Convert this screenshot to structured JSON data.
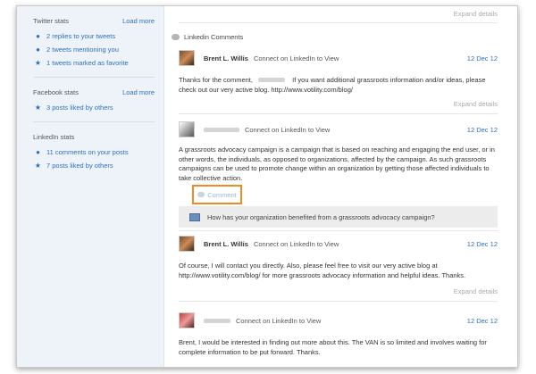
{
  "sidebar": {
    "twitter": {
      "title": "Twitter stats",
      "load_more": "Load more",
      "items": [
        {
          "icon": "speech-bubble-icon",
          "label": "2 replies to your tweets"
        },
        {
          "icon": "speech-bubble-icon",
          "label": "2 tweets mentioning you"
        },
        {
          "icon": "star-icon",
          "label": "1 tweets marked as favorite"
        }
      ]
    },
    "facebook": {
      "title": "Facebook stats",
      "load_more": "Load more",
      "items": [
        {
          "icon": "star-icon",
          "label": "3 posts liked by others"
        }
      ]
    },
    "linkedin": {
      "title": "LinkedIn stats",
      "items": [
        {
          "icon": "speech-bubble-icon",
          "label": "11 comments on your posts"
        },
        {
          "icon": "star-icon",
          "label": "7 posts liked by others"
        }
      ]
    }
  },
  "main": {
    "expand_top": "Expand details",
    "section_title": "Linkedin Comments",
    "entries": [
      {
        "author": "Brent L. Willis",
        "connect": "Connect on LinkedIn to View",
        "date": "12 Dec 12",
        "text_a": "Thanks for the comment,",
        "text_b": "If you want additional grassroots information and/or ideas, please check out our very active blog.  http://www.votility.com/blog/",
        "expand": "Expand details"
      },
      {
        "author": "",
        "connect": "Connect on LinkedIn to View",
        "date": "12 Dec 12",
        "text": "A grassroots advocacy campaign is a campaign that is based on reaching and engaging the end user, or in other words, the individuals, as opposed to organizations, affected by the campaign. As such grassroots campaigns can be used to promote change within an organization by getting those affected individuals to take collective action.",
        "comment_label": "Comment",
        "question": "How has your organization benefited from a grassroots advocacy campaign?"
      },
      {
        "author": "Brent L. Willis",
        "connect": "Connect on LinkedIn to View",
        "date": "12 Dec 12",
        "text": "Of course, I will contact you directly.  Also, please feel free to visit our very active blog at http://www.votility.com/blog/ for more grassroots advocacy information and helpful ideas. Thanks.",
        "expand": "Expand details"
      },
      {
        "author": "",
        "connect": "Connect on LinkedIn to View",
        "date": "12 Dec 12",
        "text": "Brent, I would be interested in finding out more about this. The VAN is so limited and involves waiting for complete information to be put forward. Thanks."
      }
    ]
  }
}
